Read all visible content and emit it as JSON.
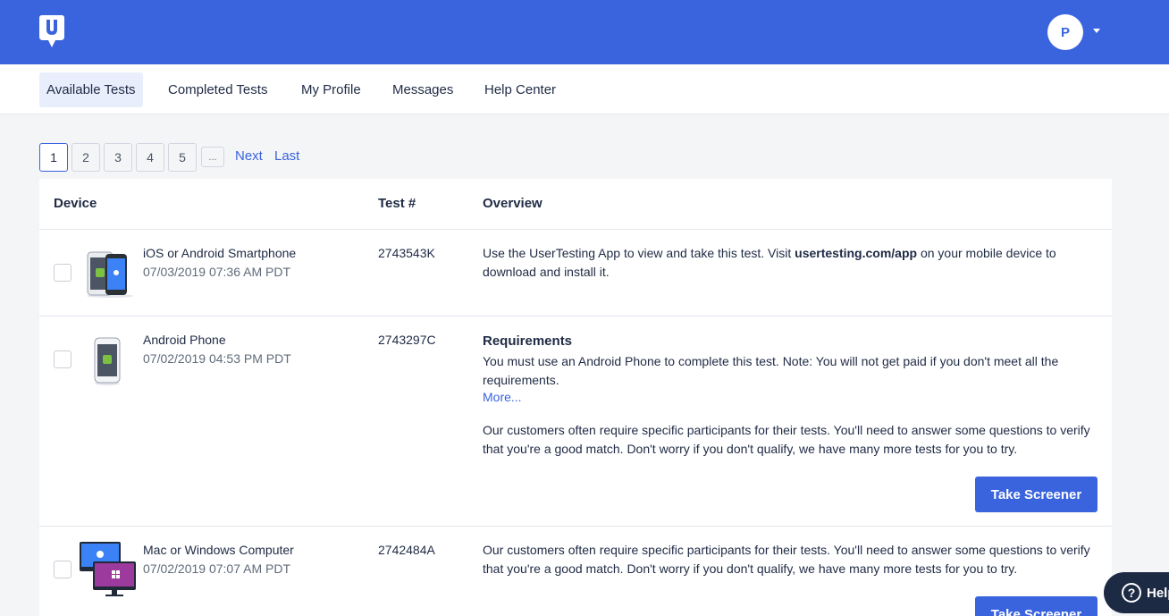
{
  "header": {
    "logo_letter": "U",
    "avatar_initial": "P",
    "brand_color": "#3a63de"
  },
  "nav": {
    "tabs": [
      {
        "label": "Available Tests",
        "active": true
      },
      {
        "label": "Completed Tests"
      },
      {
        "label": "My Profile"
      },
      {
        "label": "Messages"
      },
      {
        "label": "Help Center"
      }
    ]
  },
  "pagination": {
    "pages": [
      "1",
      "2",
      "3",
      "4",
      "5"
    ],
    "current": "1",
    "ellipsis": "...",
    "next_label": "Next",
    "last_label": "Last"
  },
  "table": {
    "columns": [
      "Device",
      "Test #",
      "Overview"
    ],
    "rows": [
      {
        "device": "iOS or Android Smartphone",
        "date": "07/03/2019 07:36 AM PDT",
        "device_icon": "smartphones-icon",
        "test_number": "2743543K",
        "overview_pre": "Use the UserTesting App to view and take this test. Visit ",
        "overview_bold": "usertesting.com/app",
        "overview_post": " on your mobile device to download and install it."
      },
      {
        "device": "Android Phone",
        "date": "07/02/2019 04:53 PM PDT",
        "device_icon": "android-phone-icon",
        "test_number": "2743297C",
        "requirements_title": "Requirements",
        "requirements_text": "You must use an Android Phone to complete this test. Note: You will not get paid if you don't meet all the requirements.",
        "more_label": "More...",
        "overview": "Our customers often require specific participants for their tests. You'll need to answer some questions to verify that you're a good match. Don't worry if you don't qualify, we have many more tests for you to try.",
        "button_label": "Take Screener"
      },
      {
        "device": "Mac or Windows Computer",
        "date": "07/02/2019 07:07 AM PDT",
        "device_icon": "computers-icon",
        "test_number": "2742484A",
        "overview": "Our customers often require specific participants for their tests. You'll need to answer some questions to verify that you're a good match. Don't worry if you don't qualify, we have many more tests for you to try.",
        "button_label": "Take Screener"
      }
    ]
  },
  "help_widget": {
    "icon": "?",
    "label": "Help"
  }
}
